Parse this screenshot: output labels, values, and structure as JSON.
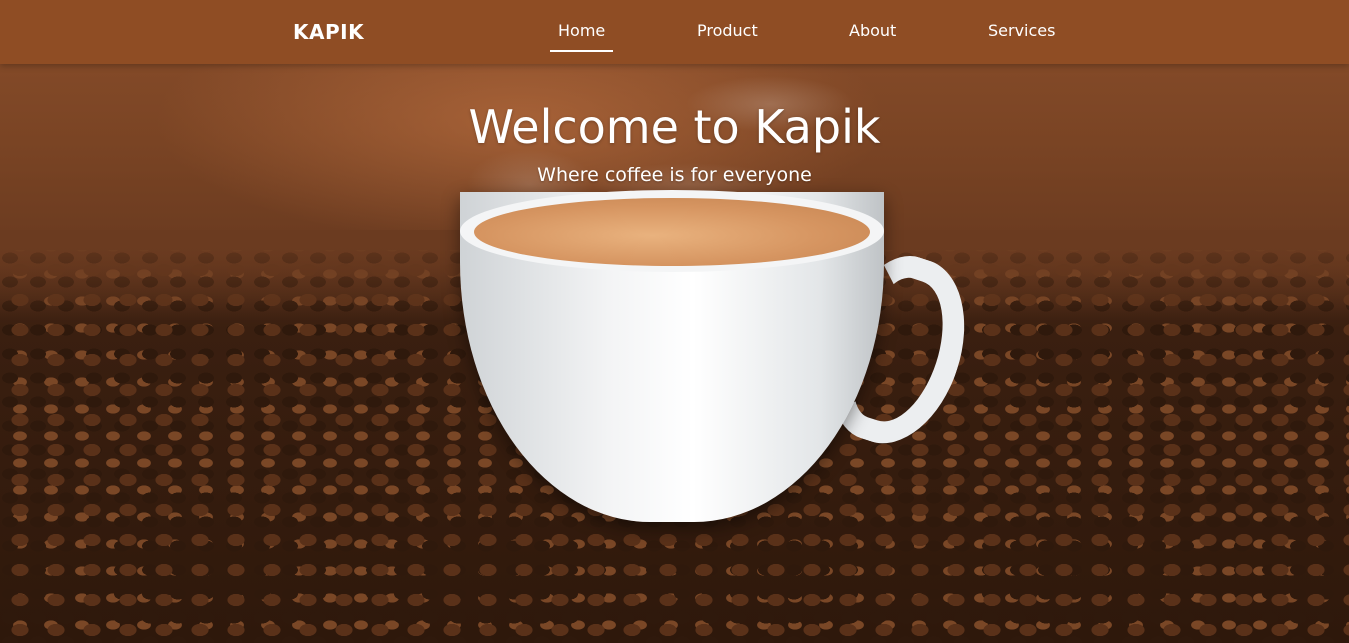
{
  "navbar": {
    "brand": "KAPIK",
    "items": [
      {
        "label": "Home",
        "active": true
      },
      {
        "label": "Product",
        "active": false
      },
      {
        "label": "About",
        "active": false
      },
      {
        "label": "Services",
        "active": false
      }
    ]
  },
  "hero": {
    "title": "Welcome to Kapik",
    "subtitle": "Where coffee is for everyone"
  },
  "colors": {
    "navbar_bg": "#8f4d24",
    "text": "#ffffff"
  }
}
